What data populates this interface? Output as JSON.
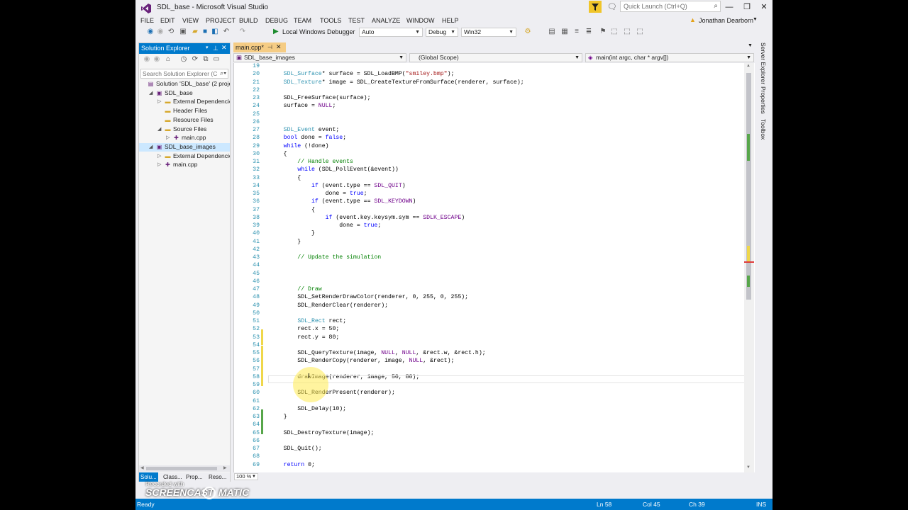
{
  "window": {
    "title": "SDL_base - Microsoft Visual Studio",
    "quick_launch_placeholder": "Quick Launch (Ctrl+Q)",
    "user": "Jonathan Dearborn",
    "controls": {
      "minimize": "—",
      "restore": "❐",
      "close": "✕"
    }
  },
  "menu": [
    "FILE",
    "EDIT",
    "VIEW",
    "PROJECT",
    "BUILD",
    "DEBUG",
    "TEAM",
    "TOOLS",
    "TEST",
    "ANALYZE",
    "WINDOW",
    "HELP"
  ],
  "toolbar": {
    "start_label": "Local Windows Debugger",
    "combo_auto": "Auto",
    "config": "Debug",
    "platform": "Win32"
  },
  "solution_explorer": {
    "title": "Solution Explorer",
    "search_placeholder": "Search Solution Explorer (C",
    "items": [
      {
        "label": "Solution 'SDL_base' (2 projec",
        "indent": 0,
        "arrow": "",
        "icon": "solution-icon"
      },
      {
        "label": "SDL_base",
        "indent": 1,
        "arrow": "◢",
        "icon": "project-icon"
      },
      {
        "label": "External Dependencie",
        "indent": 2,
        "arrow": "▷",
        "icon": "folder-icon"
      },
      {
        "label": "Header Files",
        "indent": 2,
        "arrow": "",
        "icon": "folder-icon"
      },
      {
        "label": "Resource Files",
        "indent": 2,
        "arrow": "",
        "icon": "folder-icon"
      },
      {
        "label": "Source Files",
        "indent": 2,
        "arrow": "◢",
        "icon": "folder-icon"
      },
      {
        "label": "main.cpp",
        "indent": 3,
        "arrow": "▷",
        "icon": "cpp-file-icon"
      },
      {
        "label": "SDL_base_images",
        "indent": 1,
        "arrow": "◢",
        "icon": "project-icon",
        "selected": true
      },
      {
        "label": "External Dependencie",
        "indent": 2,
        "arrow": "▷",
        "icon": "folder-icon"
      },
      {
        "label": "main.cpp",
        "indent": 2,
        "arrow": "▷",
        "icon": "cpp-file-icon"
      }
    ],
    "tabs": [
      "Solu...",
      "Class...",
      "Prop...",
      "Reso..."
    ]
  },
  "editor": {
    "tab_label": "main.cpp*",
    "nav_project": "SDL_base_images",
    "nav_scope": "(Global Scope)",
    "nav_function": "main(int argc, char * argv[])",
    "zoom": "100 %",
    "lines": [
      {
        "n": "19",
        "t": ""
      },
      {
        "n": "20",
        "t": "    SDL_Surface* surface = SDL_LoadBMP(\"smiley.bmp\");"
      },
      {
        "n": "21",
        "t": "    SDL_Texture* image = SDL_CreateTextureFromSurface(renderer, surface);"
      },
      {
        "n": "22",
        "t": ""
      },
      {
        "n": "23",
        "t": "    SDL_FreeSurface(surface);"
      },
      {
        "n": "24",
        "t": "    surface = NULL;"
      },
      {
        "n": "25",
        "t": ""
      },
      {
        "n": "26",
        "t": ""
      },
      {
        "n": "27",
        "t": "    SDL_Event event;"
      },
      {
        "n": "28",
        "t": "    bool done = false;"
      },
      {
        "n": "29",
        "t": "    while (!done)"
      },
      {
        "n": "30",
        "t": "    {"
      },
      {
        "n": "31",
        "t": "        // Handle events"
      },
      {
        "n": "32",
        "t": "        while (SDL_PollEvent(&event))"
      },
      {
        "n": "33",
        "t": "        {"
      },
      {
        "n": "34",
        "t": "            if (event.type == SDL_QUIT)"
      },
      {
        "n": "35",
        "t": "                done = true;"
      },
      {
        "n": "36",
        "t": "            if (event.type == SDL_KEYDOWN)"
      },
      {
        "n": "37",
        "t": "            {"
      },
      {
        "n": "38",
        "t": "                if (event.key.keysym.sym == SDLK_ESCAPE)"
      },
      {
        "n": "39",
        "t": "                    done = true;"
      },
      {
        "n": "40",
        "t": "            }"
      },
      {
        "n": "41",
        "t": "        }"
      },
      {
        "n": "42",
        "t": ""
      },
      {
        "n": "43",
        "t": "        // Update the simulation"
      },
      {
        "n": "44",
        "t": ""
      },
      {
        "n": "45",
        "t": ""
      },
      {
        "n": "46",
        "t": ""
      },
      {
        "n": "47",
        "t": "        // Draw"
      },
      {
        "n": "48",
        "t": "        SDL_SetRenderDrawColor(renderer, 0, 255, 0, 255);"
      },
      {
        "n": "49",
        "t": "        SDL_RenderClear(renderer);"
      },
      {
        "n": "50",
        "t": ""
      },
      {
        "n": "51",
        "t": "        SDL_Rect rect;"
      },
      {
        "n": "52",
        "t": "        rect.x = 50;"
      },
      {
        "n": "53",
        "t": "        rect.y = 80;"
      },
      {
        "n": "54",
        "t": ""
      },
      {
        "n": "55",
        "t": "        SDL_QueryTexture(image, NULL, NULL, &rect.w, &rect.h);"
      },
      {
        "n": "56",
        "t": "        SDL_RenderCopy(renderer, image, NULL, &rect);"
      },
      {
        "n": "57",
        "t": ""
      },
      {
        "n": "58",
        "t": "        drawImage(renderer, image, 50, 80);"
      },
      {
        "n": "59",
        "t": ""
      },
      {
        "n": "60",
        "t": "        SDL_RenderPresent(renderer);"
      },
      {
        "n": "61",
        "t": ""
      },
      {
        "n": "62",
        "t": "        SDL_Delay(10);"
      },
      {
        "n": "63",
        "t": "    }"
      },
      {
        "n": "64",
        "t": ""
      },
      {
        "n": "65",
        "t": "    SDL_DestroyTexture(image);"
      },
      {
        "n": "66",
        "t": ""
      },
      {
        "n": "67",
        "t": "    SDL_Quit();"
      },
      {
        "n": "68",
        "t": ""
      },
      {
        "n": "69",
        "t": "    return 0;"
      }
    ]
  },
  "right_tabs": [
    "Server Explorer",
    "Properties",
    "Toolbox"
  ],
  "status": {
    "ready": "Ready",
    "line": "Ln 58",
    "col": "Col 45",
    "ch": "Ch 39",
    "mode": "INS"
  },
  "watermark": {
    "recorded_with": "Recorded with",
    "brand": "SCREENCAST",
    "brand2": "MATIC"
  },
  "colors": {
    "accent": "#007acc",
    "keyword": "#0000ff",
    "comment": "#008000",
    "type": "#2b91af",
    "macro": "#6f008a",
    "string": "#a31515",
    "saved_change": "#57a64a",
    "unsaved_change": "#efd74a"
  }
}
